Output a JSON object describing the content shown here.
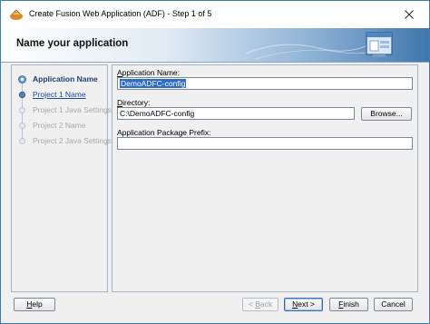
{
  "window": {
    "title": "Create Fusion Web Application (ADF) - Step 1 of 5",
    "close_icon": "close-icon",
    "app_icon": "jdeveloper-app-icon"
  },
  "header": {
    "title": "Name your application",
    "icon": "wizard-window-icon"
  },
  "nav": {
    "items": [
      {
        "label": "Application Name",
        "state": "active"
      },
      {
        "label": "Project 1 Name",
        "state": "link"
      },
      {
        "label": "Project 1 Java Settings",
        "state": "disabled"
      },
      {
        "label": "Project 2 Name",
        "state": "disabled"
      },
      {
        "label": "Project 2 Java Settings",
        "state": "disabled"
      }
    ]
  },
  "form": {
    "app_name": {
      "label_mnemonic": "A",
      "label_rest": "pplication Name:",
      "value": "DemoADFC-config"
    },
    "directory": {
      "label_mnemonic": "D",
      "label_rest": "irectory:",
      "value": "C:\\DemoADFC-config"
    },
    "browse_label": "Browse...",
    "package_prefix": {
      "label_mnemonic": "",
      "label_rest": "Application Package Prefix:",
      "value": ""
    }
  },
  "buttons": {
    "help": {
      "mnemonic": "H",
      "rest": "elp"
    },
    "back": {
      "mnemonic": "B",
      "prefix": "< ",
      "rest": "ack"
    },
    "next": {
      "mnemonic": "N",
      "rest": "ext >"
    },
    "finish": {
      "mnemonic": "F",
      "rest": "inish"
    },
    "cancel": "Cancel"
  },
  "colors": {
    "accent": "#2c6ccf",
    "link": "#1b4aa3",
    "banner_dark": "#3f77ad"
  }
}
